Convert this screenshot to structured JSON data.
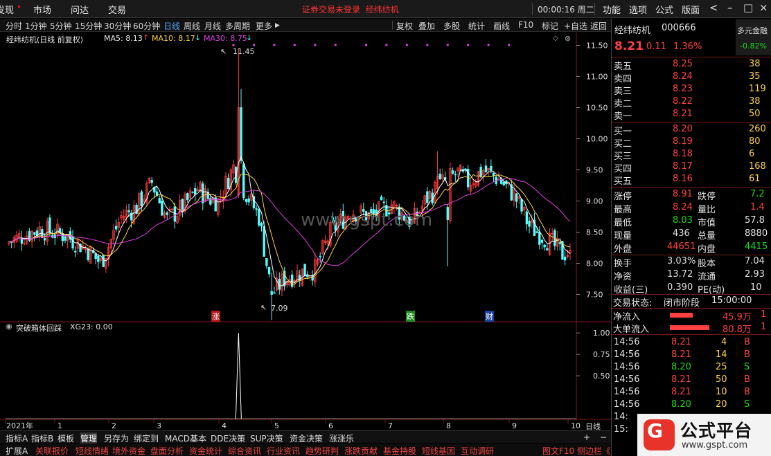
{
  "topbar": {
    "menus": [
      "发现",
      "市场",
      "问达",
      "交易"
    ],
    "notice": "证券交易未登录",
    "notice_name": "经纬纺机",
    "clock": "00:00:16 周二",
    "right_menus": [
      "功能",
      "选项",
      "公式",
      "版面"
    ],
    "controls": [
      "<",
      "–",
      "□",
      "×"
    ]
  },
  "period_tabs": [
    "分时",
    "1分钟",
    "5分钟",
    "15分钟",
    "30分钟",
    "60分钟",
    "日线",
    "周线",
    "月线",
    "多周期",
    "更多"
  ],
  "active_period": "日线",
  "tools": [
    "复权",
    "叠加",
    "多股",
    "统计",
    "画线",
    "F10",
    "标记",
    "+自选",
    "返回"
  ],
  "main_chart": {
    "title": "经纬纺机(日线 前复权)",
    "ma5_label": "MA5: 8.13",
    "ma10_label": "MA10: 8.17",
    "ma30_label": "MA30: 8.75",
    "ma5_color": "#ffffff",
    "ma10_color": "#ffd24a",
    "ma30_color": "#e040e0",
    "up_color": "#ff3b3b",
    "down_color": "#54ffff",
    "high_marker": "11.45",
    "low_marker": "7.09",
    "watermark": "www.gspt.com",
    "event_zhang": "涨",
    "event_die": "跌",
    "event_cai": "财"
  },
  "chart_data": {
    "type": "candlestick",
    "title": "经纬纺机(日线 前复权)",
    "y_ticks": [
      "11.50",
      "11.00",
      "10.50",
      "10.00",
      "9.50",
      "9.00",
      "8.50",
      "8.00",
      "7.50"
    ],
    "ylim": [
      7.15,
      11.55
    ],
    "x_month_labels": [
      "2021年",
      "1",
      "2",
      "3",
      "4",
      "5",
      "6",
      "7",
      "8",
      "9",
      "10"
    ],
    "x_right_label": "日线",
    "highest": 11.45,
    "lowest": 7.09,
    "indicator": {
      "name": "突破箱体回踩",
      "label": "XG23: 0.00",
      "y_ticks": [
        "1.00",
        "0.75",
        "0.50"
      ],
      "ylim": [
        0,
        1.05
      ],
      "spike_value": 1.0
    }
  },
  "quote": {
    "name": "经纬纺机",
    "code": "000666",
    "price": "8.21",
    "change": "0.11",
    "pct": "1.36%",
    "tag": "多元金融",
    "tag_pct": "-0.82%",
    "asks": [
      {
        "label": "卖五",
        "price": "8.25",
        "vol": "38"
      },
      {
        "label": "卖四",
        "price": "8.24",
        "vol": "35"
      },
      {
        "label": "卖三",
        "price": "8.23",
        "vol": "119"
      },
      {
        "label": "卖二",
        "price": "8.22",
        "vol": "38"
      },
      {
        "label": "卖一",
        "price": "8.21",
        "vol": "50"
      }
    ],
    "bids": [
      {
        "label": "买一",
        "price": "8.20",
        "vol": "260"
      },
      {
        "label": "买二",
        "price": "8.19",
        "vol": "80"
      },
      {
        "label": "买三",
        "price": "8.18",
        "vol": "6"
      },
      {
        "label": "买四",
        "price": "8.17",
        "vol": "168"
      },
      {
        "label": "买五",
        "price": "8.16",
        "vol": "61"
      }
    ],
    "stats": [
      {
        "l1": "涨停",
        "v1": "8.91",
        "c1": "red",
        "l2": "跌停",
        "v2": "7.2",
        "c2": "green"
      },
      {
        "l1": "最高",
        "v1": "8.24",
        "c1": "red",
        "l2": "量比",
        "v2": "1.4",
        "c2": "red"
      },
      {
        "l1": "最低",
        "v1": "8.03",
        "c1": "green",
        "l2": "市值",
        "v2": "57.8",
        "c2": "white"
      },
      {
        "l1": "现量",
        "v1": "436",
        "c1": "white",
        "l2": "总量",
        "v2": "8880",
        "c2": "white"
      },
      {
        "l1": "外盘",
        "v1": "44651",
        "c1": "red",
        "l2": "内盘",
        "v2": "4415",
        "c2": "green"
      },
      {
        "l1": "换手",
        "v1": "3.03%",
        "c1": "white",
        "l2": "股本",
        "v2": "7.04",
        "c2": "white"
      },
      {
        "l1": "净资",
        "v1": "13.72",
        "c1": "white",
        "l2": "流通",
        "v2": "2.93",
        "c2": "white"
      },
      {
        "l1": "收益(三)",
        "v1": "0.390",
        "c1": "white",
        "l2": "PE(动)",
        "v2": "10",
        "c2": "white"
      }
    ],
    "status_label": "交易状态:",
    "status_value": "闭市阶段",
    "status_time": "15:00:00",
    "net_inflow_label": "净流入",
    "net_inflow_value": "45.9万",
    "net_inflow_bar": 0.55,
    "big_inflow_label": "大单流入",
    "big_inflow_value": "80.8万",
    "big_inflow_bar": 0.95,
    "flow_tail_1": "1",
    "flow_tail_2": "1",
    "ticks": [
      {
        "time": "14:56",
        "price": "8.21",
        "vol": "4",
        "bs": "B"
      },
      {
        "time": "14:56",
        "price": "8.21",
        "vol": "14",
        "bs": "B"
      },
      {
        "time": "14:56",
        "price": "8.20",
        "vol": "25",
        "bs": "S"
      },
      {
        "time": "14:56",
        "price": "8.21",
        "vol": "50",
        "bs": "B"
      },
      {
        "time": "14:56",
        "price": "8.21",
        "vol": "10",
        "bs": "B"
      },
      {
        "time": "14:56",
        "price": "8.20",
        "vol": "20",
        "bs": "S"
      },
      {
        "time": "14:",
        "price": "",
        "vol": "",
        "bs": ""
      },
      {
        "time": "15:",
        "price": "",
        "vol": "",
        "bs": ""
      }
    ]
  },
  "bottom_tabs": [
    "指标A",
    "指标B",
    "模板",
    "管理",
    "另存为",
    "绑定到",
    "MACD基本",
    "DDE决策",
    "SUP决策",
    "资金决策",
    "涨涨乐"
  ],
  "bottom_tabs_active": "管理",
  "bottom_tab_controls": [
    "+",
    "−"
  ],
  "bottom_links": [
    "扩展A",
    "关联报价",
    "短线情绪",
    "境外资金",
    "盘面分析",
    "资金统计",
    "综合资讯",
    "行业资讯",
    "趋势研判",
    "涨跌贡献",
    "基金持股",
    "短线基因",
    "互动调研"
  ],
  "bottom_right": "图文F10 侧边栏《",
  "logo": {
    "title": "公式平台",
    "url": "www.gspt.com"
  }
}
